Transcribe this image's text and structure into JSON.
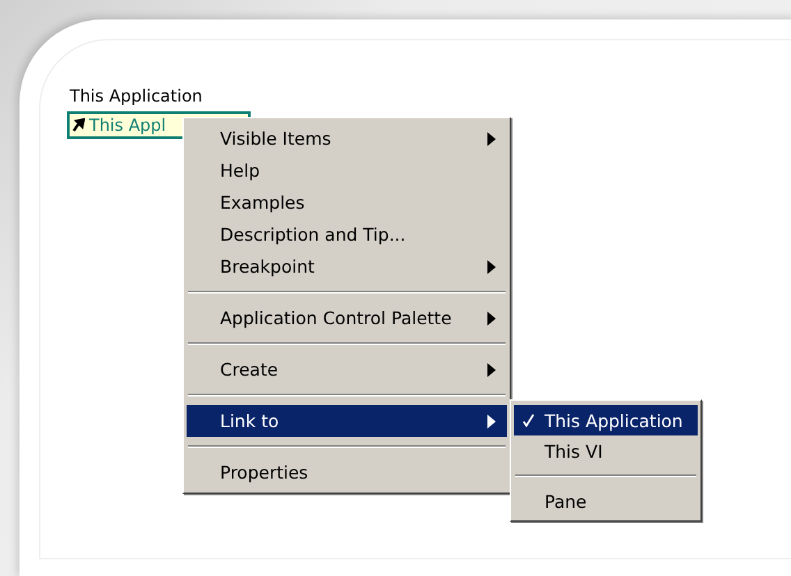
{
  "label": "This Application",
  "control": {
    "text": "This Appl"
  },
  "menu": [
    {
      "kind": "item",
      "label": "Visible Items",
      "submenu": true,
      "selected": false
    },
    {
      "kind": "item",
      "label": "Help",
      "submenu": false,
      "selected": false
    },
    {
      "kind": "item",
      "label": "Examples",
      "submenu": false,
      "selected": false
    },
    {
      "kind": "item",
      "label": "Description and Tip...",
      "submenu": false,
      "selected": false
    },
    {
      "kind": "item",
      "label": "Breakpoint",
      "submenu": true,
      "selected": false
    },
    {
      "kind": "separator"
    },
    {
      "kind": "item",
      "label": "Application Control Palette",
      "submenu": true,
      "selected": false
    },
    {
      "kind": "separator"
    },
    {
      "kind": "item",
      "label": "Create",
      "submenu": true,
      "selected": false
    },
    {
      "kind": "separator"
    },
    {
      "kind": "item",
      "label": "Link to",
      "submenu": true,
      "selected": true
    },
    {
      "kind": "separator"
    },
    {
      "kind": "item",
      "label": "Properties",
      "submenu": false,
      "selected": false
    }
  ],
  "submenu": [
    {
      "kind": "item",
      "label": "This Application",
      "checked": true,
      "selected": true
    },
    {
      "kind": "item",
      "label": "This VI",
      "checked": false,
      "selected": false
    },
    {
      "kind": "separator"
    },
    {
      "kind": "item",
      "label": "Pane",
      "checked": false,
      "selected": false
    }
  ]
}
